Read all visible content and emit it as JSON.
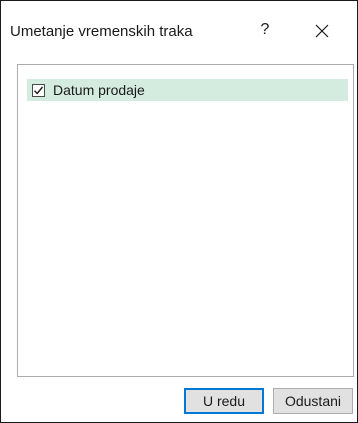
{
  "dialog": {
    "title": "Umetanje vremenskih traka",
    "help_label": "?",
    "close_icon": "close-icon"
  },
  "list": {
    "items": [
      {
        "label": "Datum prodaje",
        "checked": true
      }
    ],
    "selected_color": "#d4ebe0"
  },
  "buttons": {
    "ok_label": "U redu",
    "cancel_label": "Odustani",
    "accent_color": "#0078d7"
  }
}
